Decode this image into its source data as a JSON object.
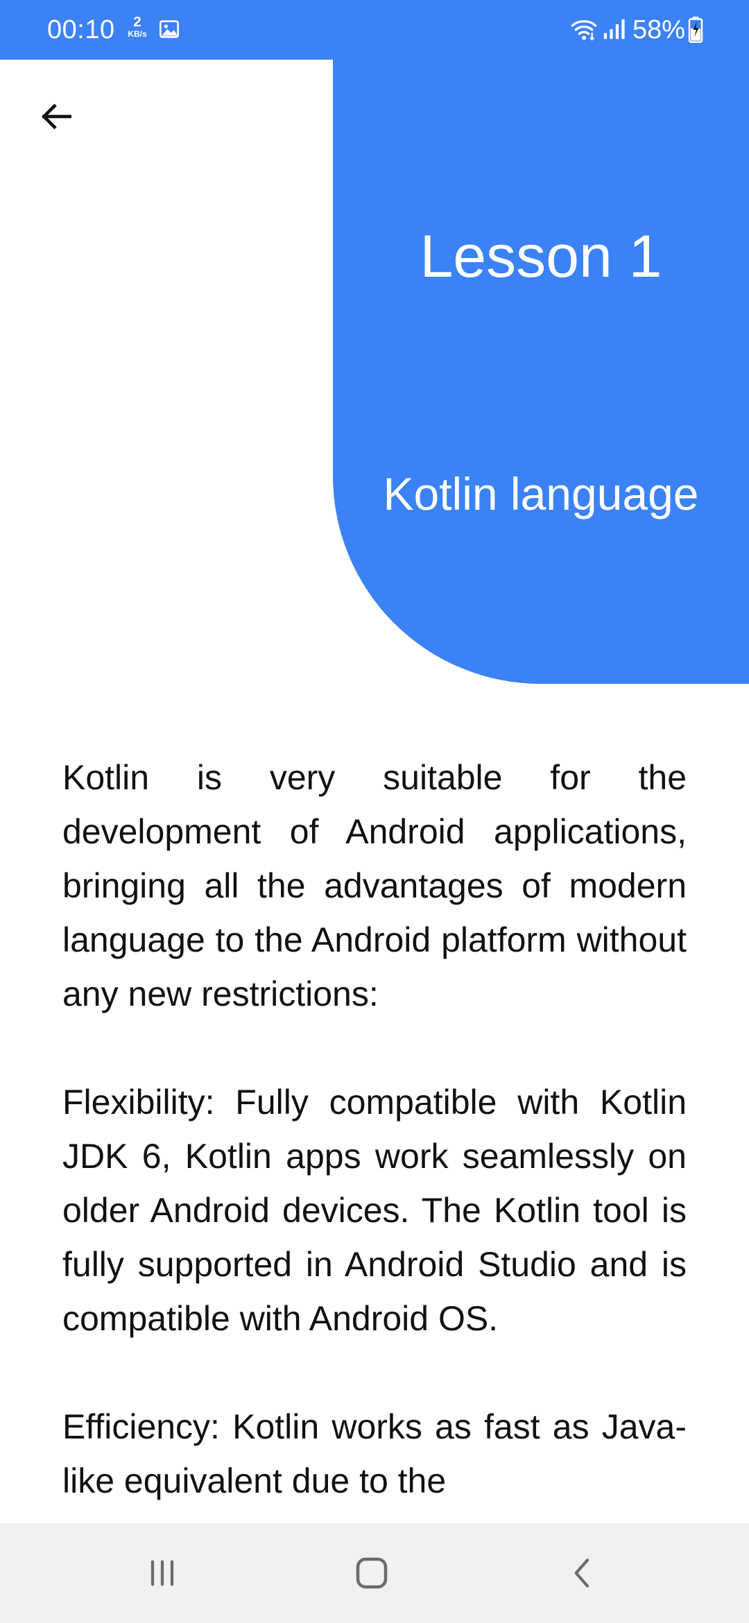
{
  "status_bar": {
    "time": "00:10",
    "speed_value": "2",
    "speed_unit": "KB/s",
    "battery": "58%",
    "icons": [
      "image-icon",
      "wifi-icon",
      "signal-icon",
      "battery-icon"
    ]
  },
  "header": {
    "back_icon": "arrow-left-icon",
    "title": "Lesson 1",
    "subtitle": "Kotlin language"
  },
  "content": {
    "paragraphs": [
      "Kotlin is very suitable for the development of Android applications, bringing all the advantages of modern language to the Android platform without any new restrictions:",
      "Flexibility: Fully compatible with Kotlin JDK 6, Kotlin apps work seamlessly on older Android devices. The Kotlin tool is fully supported in Android Studio and is compatible with Android OS.",
      "Efficiency: Kotlin works as fast as Java-like equivalent due to the"
    ]
  },
  "nav_bar": {
    "buttons": [
      "recents-icon",
      "home-icon",
      "back-icon"
    ]
  },
  "colors": {
    "accent": "#3B82F6",
    "nav_background": "#F1F1F1",
    "text": "#111111"
  }
}
